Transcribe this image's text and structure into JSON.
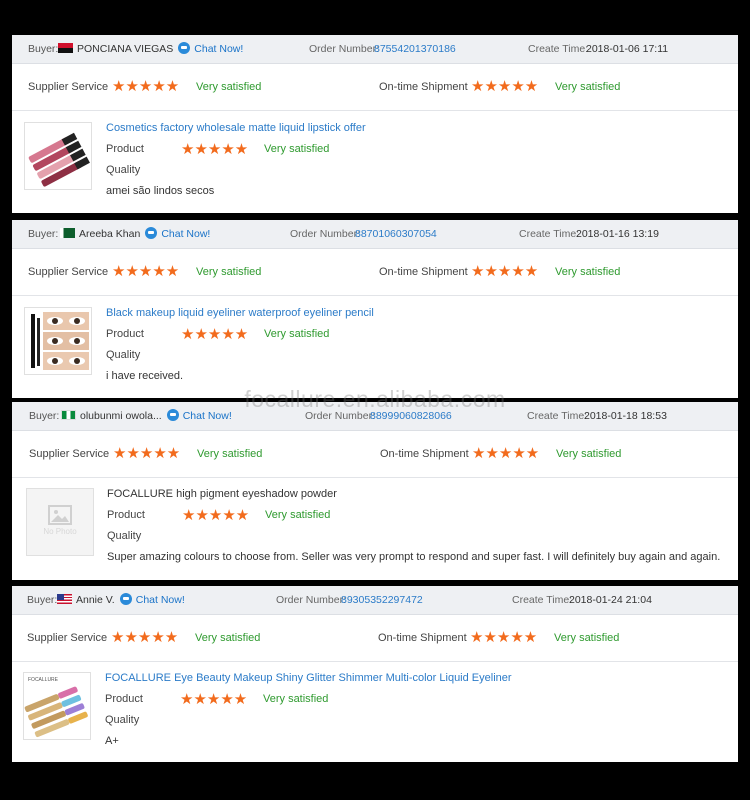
{
  "common": {
    "buyer_label": "Buyer:",
    "chat_label": "Chat Now!",
    "order_label": "Order Number:",
    "time_label": "Create Time:",
    "supplier_service": "Supplier Service",
    "ontime_shipment": "On-time Shipment",
    "product_label": "Product",
    "quality_label": "Quality",
    "stars": "★★★★★",
    "satisfied": "Very satisfied",
    "no_photo": "No Photo"
  },
  "watermark": "focallure.en.alibaba.com",
  "reviews": [
    {
      "buyer": "PONCIANA VIEGAS",
      "flag": "angola-flag-icon",
      "order_number": "87554201370186",
      "create_time": "2018-01-06 17:11",
      "product_title": "Cosmetics factory wholesale matte liquid lipstick offer",
      "comment": "amei são lindos secos"
    },
    {
      "buyer": "Areeba Khan",
      "flag": "pakistan-flag-icon",
      "order_number": "88701060307054",
      "create_time": "2018-01-16 13:19",
      "product_title": "Black makeup liquid eyeliner waterproof eyeliner pencil",
      "comment": "i have received."
    },
    {
      "buyer": "olubunmi owola...",
      "flag": "nigeria-flag-icon",
      "order_number": "88999060828066",
      "create_time": "2018-01-18 18:53",
      "product_title": "FOCALLURE high pigment eyeshadow powder",
      "comment": "Super amazing colours to choose from. Seller was very prompt to respond and super fast. I will definitely buy again and again."
    },
    {
      "buyer": "Annie V.",
      "flag": "usa-flag-icon",
      "order_number": "89305352297472",
      "create_time": "2018-01-24 21:04",
      "product_title": "FOCALLURE Eye Beauty Makeup Shiny Glitter Shimmer Multi-color Liquid Eyeliner",
      "comment": "A+",
      "thumb_label": "FOCALLURE"
    }
  ],
  "colors": {
    "star": "#f26b1d",
    "satisfied_text": "#2f9a2f",
    "link": "#2b7bc8",
    "header_bg": "#eef0f3"
  }
}
